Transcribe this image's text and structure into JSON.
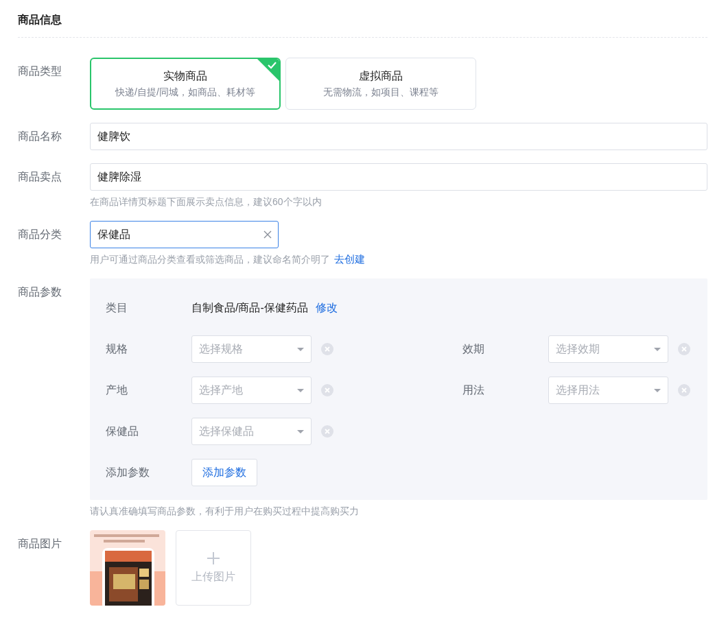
{
  "section_title": "商品信息",
  "product_type": {
    "label": "商品类型",
    "options": [
      {
        "title": "实物商品",
        "desc": "快递/自提/同城，如商品、耗材等",
        "selected": true
      },
      {
        "title": "虚拟商品",
        "desc": "无需物流，如项目、课程等",
        "selected": false
      }
    ]
  },
  "name": {
    "label": "商品名称",
    "value": "健脾饮"
  },
  "selling_point": {
    "label": "商品卖点",
    "value": "健脾除湿",
    "hint": "在商品详情页标题下面展示卖点信息，建议60个字以内"
  },
  "category": {
    "label": "商品分类",
    "value": "保健品",
    "hint": "用户可通过商品分类查看或筛选商品，建议命名简介明了",
    "link": "去创建"
  },
  "params": {
    "label": "商品参数",
    "category_label": "类目",
    "category_value": "自制食品/商品-保健药品",
    "edit_link": "修改",
    "fields": [
      {
        "label": "规格",
        "placeholder": "选择规格"
      },
      {
        "label": "效期",
        "placeholder": "选择效期"
      },
      {
        "label": "产地",
        "placeholder": "选择产地"
      },
      {
        "label": "用法",
        "placeholder": "选择用法"
      },
      {
        "label": "保健品",
        "placeholder": "选择保健品"
      }
    ],
    "add_label": "添加参数",
    "add_button": "添加参数",
    "hint": "请认真准确填写商品参数，有利于用户在购买过程中提高购买力"
  },
  "images": {
    "label": "商品图片",
    "upload_label": "上传图片"
  }
}
